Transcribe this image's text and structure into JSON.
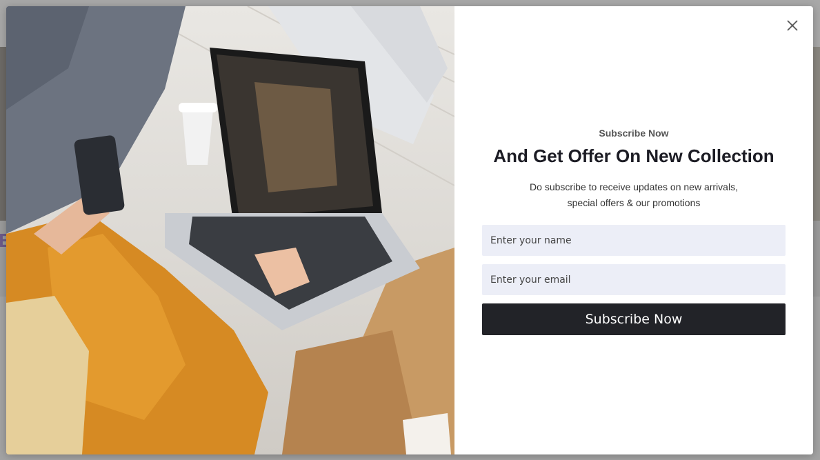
{
  "popup": {
    "eyebrow": "Subscribe Now",
    "headline": "And Get Offer On New Collection",
    "description_line1": "Do subscribe to receive updates on new arrivals,",
    "description_line2": "special offers & our promotions",
    "name_placeholder": "Enter your name",
    "email_placeholder": "Enter your email",
    "subscribe_label": "Subscribe Now",
    "close_icon": "close-icon",
    "button_color": "#222328",
    "input_bg": "#eceef7"
  },
  "background_page": {
    "partial_heading_letter": "E"
  }
}
